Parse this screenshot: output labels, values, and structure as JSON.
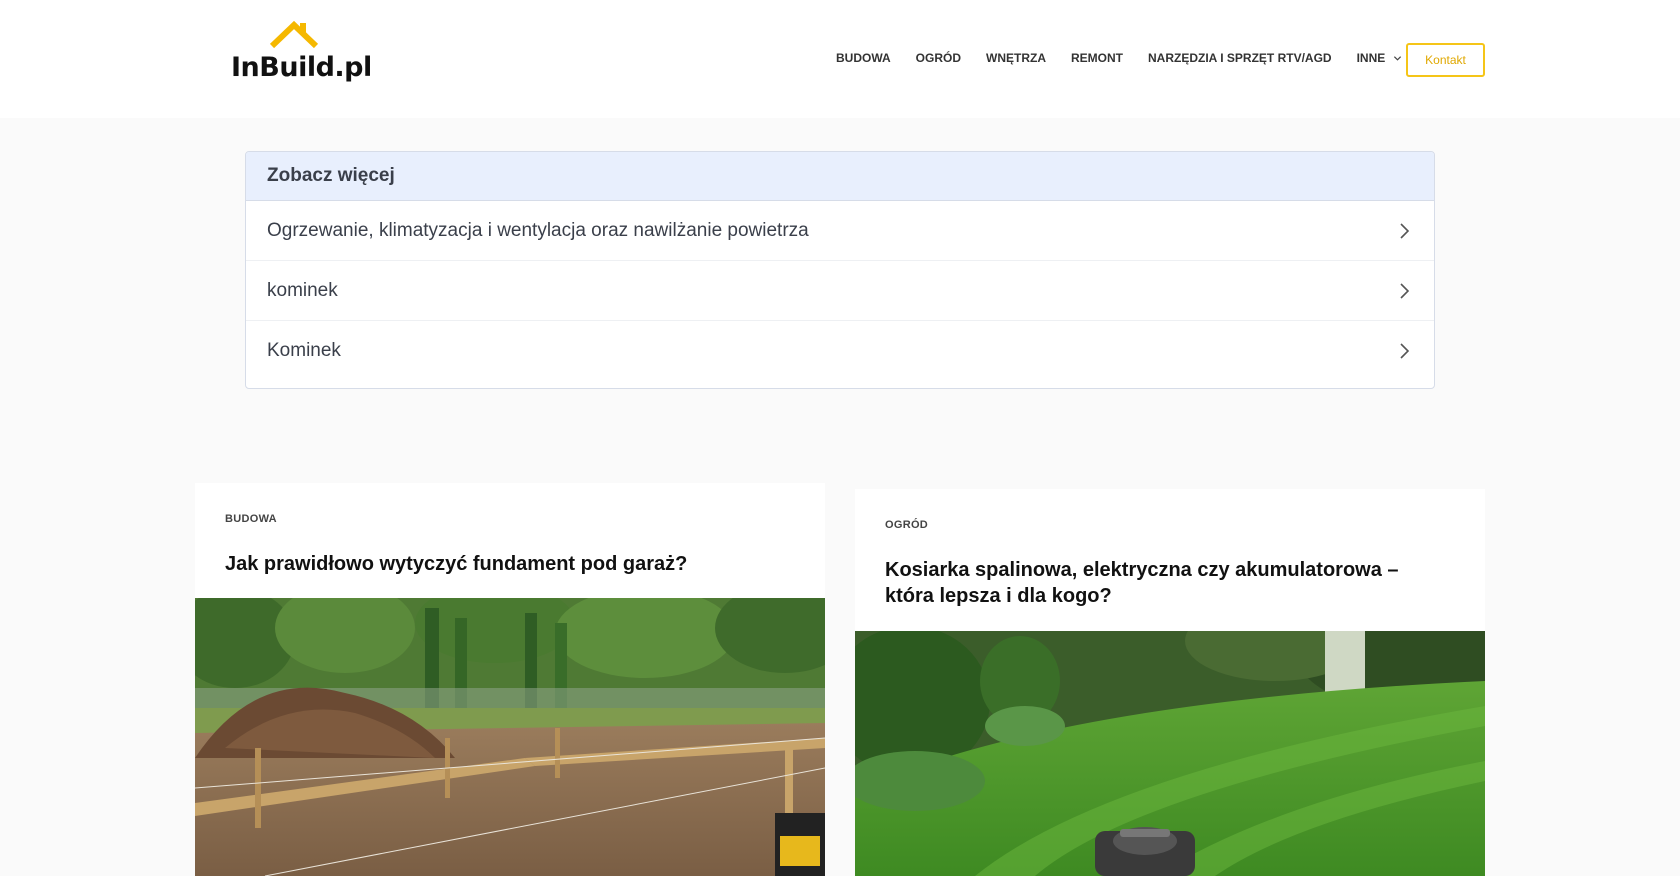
{
  "site": {
    "logo_text": "InBuild.pl"
  },
  "nav": {
    "items": [
      "BUDOWA",
      "OGRÓD",
      "WNĘTRZA",
      "REMONT",
      "NARZĘDZIA I SPRZĘT RTV/AGD"
    ],
    "more_label": "INNE",
    "contact_label": "Kontakt"
  },
  "see_more": {
    "heading": "Zobacz więcej",
    "items": [
      "Ogrzewanie, klimatyzacja i wentylacja oraz nawilżanie powietrza",
      "kominek",
      "Kominek"
    ]
  },
  "posts": [
    {
      "category": "BUDOWA",
      "title": "Jak prawidłowo wytyczyć fundament pod garaż?"
    },
    {
      "category": "OGRÓD",
      "title": "Kosiarka spalinowa, elektryczna czy akumulatorowa – która lepsza i dla kogo?"
    }
  ],
  "colors": {
    "accent": "#f5c518",
    "see_more_header_bg": "#e8effd",
    "page_bg": "#fafafa"
  },
  "icons": [
    "house-roof-icon",
    "chevron-down-icon",
    "chevron-right-icon"
  ]
}
